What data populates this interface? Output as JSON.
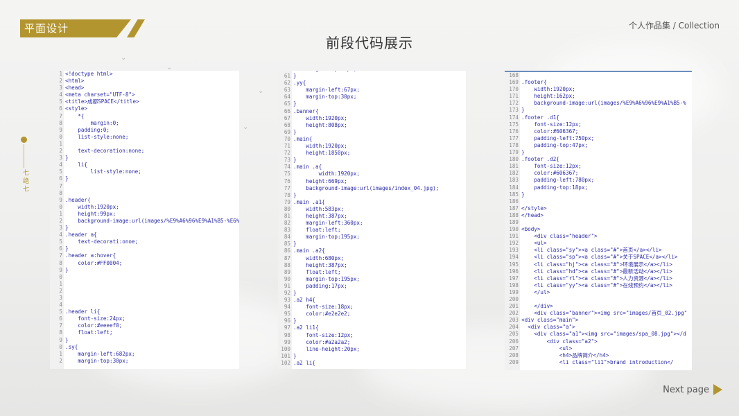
{
  "header": {
    "section_label": "平面设计",
    "collection": "个人作品集 / Collection",
    "title": "前段代码展示"
  },
  "side": {
    "vertical_text": "七 绝 七"
  },
  "footer": {
    "next_label": "Next page"
  },
  "colors": {
    "accent": "#b3952f",
    "code": "#2b2ba8",
    "line_number": "#8a8a8a"
  },
  "panels": [
    {
      "name": "html-css-code-panel-1",
      "lines": [
        {
          "n": "1",
          "c": "<!doctype html>"
        },
        {
          "n": "2",
          "c": "<html>"
        },
        {
          "n": "3",
          "c": "<head>"
        },
        {
          "n": "4",
          "c": "<meta charset=\"UTF-8\">"
        },
        {
          "n": "5",
          "c": "<title>成都SPACE</title>"
        },
        {
          "n": "6",
          "c": "<style>"
        },
        {
          "n": "7",
          "c": "    *{"
        },
        {
          "n": "8",
          "c": "        margin:0;"
        },
        {
          "n": "9",
          "c": "    padding:0;"
        },
        {
          "n": "0",
          "c": "    list-style:none;"
        },
        {
          "n": "1",
          "c": ""
        },
        {
          "n": "2",
          "c": "    text-decoration:none;"
        },
        {
          "n": "3",
          "c": "}"
        },
        {
          "n": "4",
          "c": "    li{"
        },
        {
          "n": "5",
          "c": "        list-style:none;"
        },
        {
          "n": "6",
          "c": "}"
        },
        {
          "n": "7",
          "c": ""
        },
        {
          "n": "8",
          "c": ""
        },
        {
          "n": "9",
          "c": ".header{"
        },
        {
          "n": "0",
          "c": "    width:1920px;"
        },
        {
          "n": "1",
          "c": "    height:99px;"
        },
        {
          "n": "2",
          "c": "    background-image:url(images/%E9%A6%96%E9%A1%B5-%E6%"
        },
        {
          "n": "3",
          "c": "}"
        },
        {
          "n": "4",
          "c": ".header a{"
        },
        {
          "n": "5",
          "c": "    text-decorati:onoe;"
        },
        {
          "n": "6",
          "c": "}"
        },
        {
          "n": "7",
          "c": ".header a:hover{"
        },
        {
          "n": "8",
          "c": "    color:#FF0004;"
        },
        {
          "n": "9",
          "c": "}"
        },
        {
          "n": "0",
          "c": ""
        },
        {
          "n": "1",
          "c": ""
        },
        {
          "n": "2",
          "c": ""
        },
        {
          "n": "3",
          "c": ""
        },
        {
          "n": "4",
          "c": ""
        },
        {
          "n": "5",
          "c": ".header li{"
        },
        {
          "n": "6",
          "c": "    font-size:24px;"
        },
        {
          "n": "7",
          "c": "    color:#eeeef0;"
        },
        {
          "n": "8",
          "c": "    float:left;"
        },
        {
          "n": "9",
          "c": "}"
        },
        {
          "n": "0",
          "c": ".sy{"
        },
        {
          "n": "1",
          "c": "    margin-left:682px;"
        },
        {
          "n": "2",
          "c": "    margin-top:30px;"
        }
      ]
    },
    {
      "name": "html-css-code-panel-2",
      "lines": [
        {
          "n": "60",
          "c": "    margin-top:30px;"
        },
        {
          "n": "61",
          "c": "}"
        },
        {
          "n": "62",
          "c": ".yy{"
        },
        {
          "n": "63",
          "c": "    margin-left:67px;"
        },
        {
          "n": "64",
          "c": "    margin-top:30px;"
        },
        {
          "n": "65",
          "c": "}"
        },
        {
          "n": "66",
          "c": ".banner{"
        },
        {
          "n": "67",
          "c": "    width:1920px;"
        },
        {
          "n": "68",
          "c": "    height:808px;"
        },
        {
          "n": "69",
          "c": "}"
        },
        {
          "n": "70",
          "c": ".main{"
        },
        {
          "n": "71",
          "c": "    width:1920px;"
        },
        {
          "n": "72",
          "c": "    height:1850px;"
        },
        {
          "n": "73",
          "c": "}"
        },
        {
          "n": "74",
          "c": ".main .a{"
        },
        {
          "n": "75",
          "c": "        width:1920px;"
        },
        {
          "n": "76",
          "c": "    height:669px;"
        },
        {
          "n": "77",
          "c": "    background-image:url(images/index_04.jpg);"
        },
        {
          "n": "78",
          "c": "}"
        },
        {
          "n": "79",
          "c": ".main .a1{"
        },
        {
          "n": "80",
          "c": "    width:583px;"
        },
        {
          "n": "81",
          "c": "    height:387px;"
        },
        {
          "n": "82",
          "c": "    margin-left:360px;"
        },
        {
          "n": "83",
          "c": "    float:left;"
        },
        {
          "n": "84",
          "c": "    margin-top:195px;"
        },
        {
          "n": "85",
          "c": "}"
        },
        {
          "n": "86",
          "c": ".main .a2{"
        },
        {
          "n": "87",
          "c": "    width:680px;"
        },
        {
          "n": "88",
          "c": "    height:387px;"
        },
        {
          "n": "89",
          "c": "    float:left;"
        },
        {
          "n": "90",
          "c": "    margin-top:195px;"
        },
        {
          "n": "91",
          "c": "    padding:17px;"
        },
        {
          "n": "92",
          "c": "}"
        },
        {
          "n": "93",
          "c": ".a2 h4{"
        },
        {
          "n": "94",
          "c": "    font-size:18px;"
        },
        {
          "n": "95",
          "c": "    color:#e2e2e2;"
        },
        {
          "n": "96",
          "c": "}"
        },
        {
          "n": "97",
          "c": ".a2 li1{"
        },
        {
          "n": "98",
          "c": "    font-size:12px;"
        },
        {
          "n": "99",
          "c": "    color:#a2a2a2;"
        },
        {
          "n": "100",
          "c": "    line-height:20px;"
        },
        {
          "n": "101",
          "c": "}"
        },
        {
          "n": "102",
          "c": ".a2 li{"
        }
      ]
    },
    {
      "name": "html-css-code-panel-3",
      "lines": [
        {
          "n": "168",
          "c": ""
        },
        {
          "n": "169",
          "c": ".footer{"
        },
        {
          "n": "170",
          "c": "    width:1920px;"
        },
        {
          "n": "171",
          "c": "    height:162px;"
        },
        {
          "n": "172",
          "c": "    background-image:url(images/%E9%A6%96%E9%A1%B5-%"
        },
        {
          "n": "173",
          "c": "}"
        },
        {
          "n": "174",
          "c": ".footer .d1{"
        },
        {
          "n": "175",
          "c": "    font-size:12px;"
        },
        {
          "n": "176",
          "c": "    color:#606367;"
        },
        {
          "n": "177",
          "c": "    padding-left:750px;"
        },
        {
          "n": "178",
          "c": "    padding-top:47px;"
        },
        {
          "n": "179",
          "c": "}"
        },
        {
          "n": "180",
          "c": ".footer .d2{"
        },
        {
          "n": "181",
          "c": "    font-size:12px;"
        },
        {
          "n": "182",
          "c": "    color:#606367;"
        },
        {
          "n": "183",
          "c": "    padding-left:780px;"
        },
        {
          "n": "184",
          "c": "    padding-top:18px;"
        },
        {
          "n": "185",
          "c": "}"
        },
        {
          "n": "186",
          "c": ""
        },
        {
          "n": "187",
          "c": "</style>"
        },
        {
          "n": "188",
          "c": "</head>"
        },
        {
          "n": "189",
          "c": ""
        },
        {
          "n": "190",
          "c": "<body>"
        },
        {
          "n": "191",
          "c": "    <div class=\"header\">"
        },
        {
          "n": "192",
          "c": "    <ul>"
        },
        {
          "n": "193",
          "c": "    <li class=\"sy\"><a class=\"#\">首页</a></li>"
        },
        {
          "n": "194",
          "c": "    <li class=\"sp\"><a class=\"#\">关于SPACE</a></li>"
        },
        {
          "n": "195",
          "c": "    <li class=\"hj\"><a class=\"#\">环境展示</a></li>"
        },
        {
          "n": "196",
          "c": "    <li class=\"hd\"><a class=\"#\">最新活动</a></li>"
        },
        {
          "n": "197",
          "c": "    <li class=\"rl\"><a class=\"#\">人力资源</a></li>"
        },
        {
          "n": "198",
          "c": "    <li class=\"yy\"><a class=\"#\">在线预约</a></li>"
        },
        {
          "n": "199",
          "c": "    </ul>"
        },
        {
          "n": "200",
          "c": ""
        },
        {
          "n": "201",
          "c": "    </div>"
        },
        {
          "n": "202",
          "c": "    <div class=\"banner\"><img src=\"images/首页_02.jpg\""
        },
        {
          "n": "203",
          "c": "<div class=\"main\">"
        },
        {
          "n": "204",
          "c": "  <div class=\"a\">"
        },
        {
          "n": "205",
          "c": "    <div class=\"a1\"><img src=\"images/spa_08.jpg\"></d"
        },
        {
          "n": "206",
          "c": "        <div class=\"a2\">"
        },
        {
          "n": "207",
          "c": "            <ul>"
        },
        {
          "n": "208",
          "c": "            <h4>品牌简介</h4>"
        },
        {
          "n": "209",
          "c": "            <li class=\"li1\">brand introduction</"
        }
      ]
    }
  ]
}
